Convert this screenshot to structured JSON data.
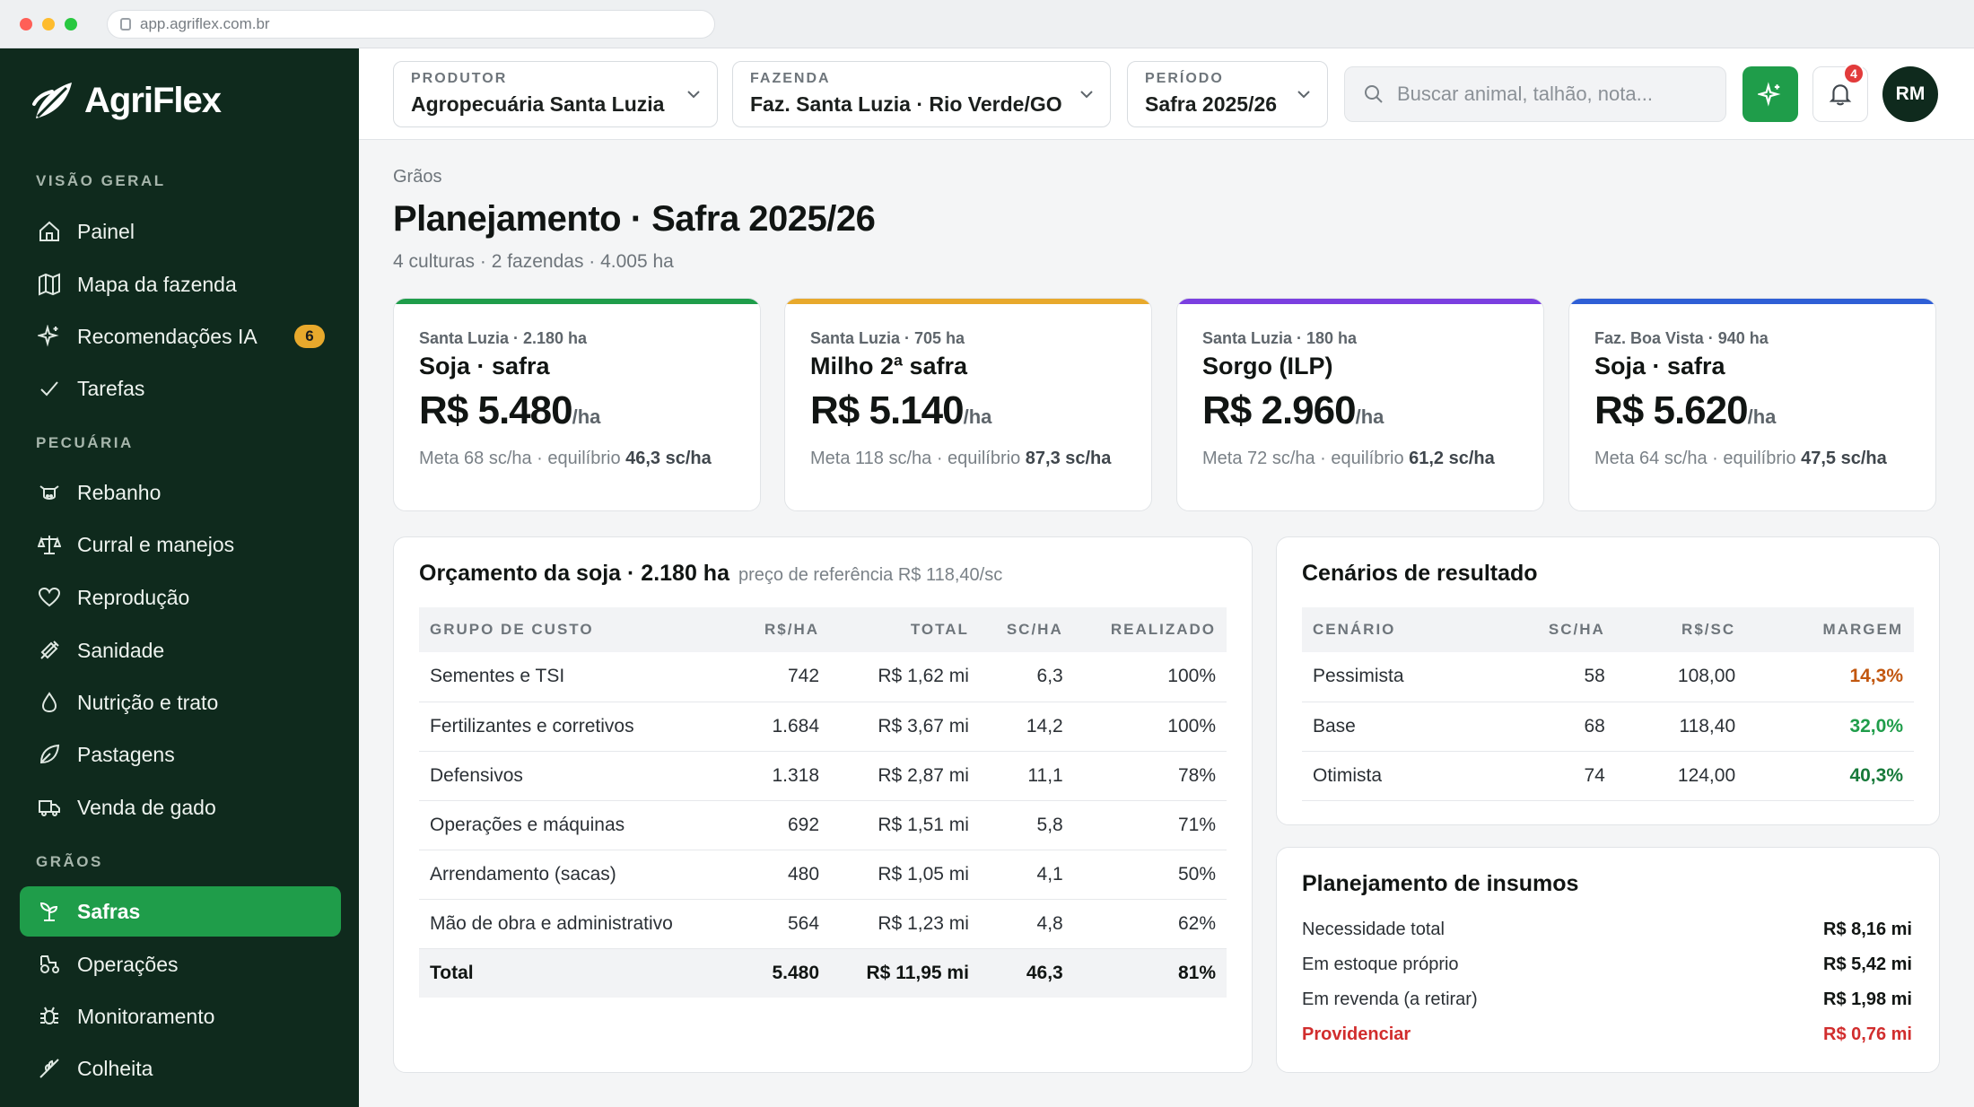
{
  "browser": {
    "url": "app.agriflex.com.br"
  },
  "brand": {
    "name": "AgriFlex",
    "accent": "#1f9d4a",
    "sidebar_bg": "#0f2a1d"
  },
  "sidebar": {
    "sections": [
      {
        "title": "VISÃO GERAL",
        "items": [
          {
            "label": "Painel",
            "icon": "home-icon"
          },
          {
            "label": "Mapa da fazenda",
            "icon": "map-icon"
          },
          {
            "label": "Recomendações IA",
            "icon": "sparkle-icon",
            "badge": "6"
          },
          {
            "label": "Tarefas",
            "icon": "check-icon"
          }
        ]
      },
      {
        "title": "PECUÁRIA",
        "items": [
          {
            "label": "Rebanho",
            "icon": "cow-icon"
          },
          {
            "label": "Curral e manejos",
            "icon": "scale-icon"
          },
          {
            "label": "Reprodução",
            "icon": "heart-icon"
          },
          {
            "label": "Sanidade",
            "icon": "syringe-icon"
          },
          {
            "label": "Nutrição e trato",
            "icon": "drop-icon"
          },
          {
            "label": "Pastagens",
            "icon": "leaf-icon"
          },
          {
            "label": "Venda de gado",
            "icon": "truck-icon"
          }
        ]
      },
      {
        "title": "GRÃOS",
        "items": [
          {
            "label": "Safras",
            "icon": "sprout-icon",
            "active": true
          },
          {
            "label": "Operações",
            "icon": "tractor-icon"
          },
          {
            "label": "Monitoramento",
            "icon": "bug-icon"
          },
          {
            "label": "Colheita",
            "icon": "wheat-icon"
          }
        ]
      }
    ]
  },
  "topbar": {
    "producer": {
      "label": "PRODUTOR",
      "value": "Agropecuária Santa Luzia"
    },
    "farm": {
      "label": "FAZENDA",
      "value": "Faz. Santa Luzia · Rio Verde/GO"
    },
    "period": {
      "label": "PERÍODO",
      "value": "Safra 2025/26"
    },
    "search_placeholder": "Buscar animal, talhão, nota...",
    "notifications": "4",
    "avatar": "RM"
  },
  "page": {
    "breadcrumb": "Grãos",
    "title": "Planejamento · Safra 2025/26",
    "subtitle": "4 culturas · 2 fazendas · 4.005 ha"
  },
  "crops": [
    {
      "meta": "Santa Luzia · 2.180 ha",
      "name": "Soja · safra",
      "price": "R$ 5.480",
      "unit": "/ha",
      "goal": "Meta 68 sc/ha · equilíbrio ",
      "breakeven": "46,3 sc/ha",
      "color": "#1f9d4a"
    },
    {
      "meta": "Santa Luzia · 705 ha",
      "name": "Milho 2ª safra",
      "price": "R$ 5.140",
      "unit": "/ha",
      "goal": "Meta 118 sc/ha · equilíbrio ",
      "breakeven": "87,3 sc/ha",
      "color": "#e8a92c"
    },
    {
      "meta": "Santa Luzia · 180 ha",
      "name": "Sorgo (ILP)",
      "price": "R$ 2.960",
      "unit": "/ha",
      "goal": "Meta 72 sc/ha · equilíbrio ",
      "breakeven": "61,2 sc/ha",
      "color": "#7b3fe0"
    },
    {
      "meta": "Faz. Boa Vista · 940 ha",
      "name": "Soja · safra",
      "price": "R$ 5.620",
      "unit": "/ha",
      "goal": "Meta 64 sc/ha · equilíbrio ",
      "breakeven": "47,5 sc/ha",
      "color": "#2f5fd6"
    }
  ],
  "budget": {
    "title": "Orçamento da soja · 2.180 ha",
    "hint": "preço de referência R$ 118,40/sc",
    "headers": [
      "GRUPO DE CUSTO",
      "R$/HA",
      "TOTAL",
      "SC/HA",
      "REALIZADO"
    ],
    "rows": [
      [
        "Sementes e TSI",
        "742",
        "R$ 1,62 mi",
        "6,3",
        "100%"
      ],
      [
        "Fertilizantes e corretivos",
        "1.684",
        "R$ 3,67 mi",
        "14,2",
        "100%"
      ],
      [
        "Defensivos",
        "1.318",
        "R$ 2,87 mi",
        "11,1",
        "78%"
      ],
      [
        "Operações e máquinas",
        "692",
        "R$ 1,51 mi",
        "5,8",
        "71%"
      ],
      [
        "Arrendamento (sacas)",
        "480",
        "R$ 1,05 mi",
        "4,1",
        "50%"
      ],
      [
        "Mão de obra e administrativo",
        "564",
        "R$ 1,23 mi",
        "4,8",
        "62%"
      ]
    ],
    "total": [
      "Total",
      "5.480",
      "R$ 11,95 mi",
      "46,3",
      "81%"
    ]
  },
  "scenarios": {
    "title": "Cenários de resultado",
    "headers": [
      "CENÁRIO",
      "SC/HA",
      "R$/SC",
      "MARGEM"
    ],
    "rows": [
      {
        "name": "Pessimista",
        "sc": "58",
        "rs": "108,00",
        "margin": "14,3%",
        "color": "#c2570f"
      },
      {
        "name": "Base",
        "sc": "68",
        "rs": "118,40",
        "margin": "32,0%",
        "color": "#1f9d4a"
      },
      {
        "name": "Otimista",
        "sc": "74",
        "rs": "124,00",
        "margin": "40,3%",
        "color": "#177a3a"
      }
    ]
  },
  "inputs": {
    "title": "Planejamento de insumos",
    "rows": [
      {
        "label": "Necessidade total",
        "value": "R$ 8,16 mi"
      },
      {
        "label": "Em estoque próprio",
        "value": "R$ 5,42 mi"
      },
      {
        "label": "Em revenda (a retirar)",
        "value": "R$ 1,98 mi"
      },
      {
        "label": "Providenciar",
        "value": "R$ 0,76 mi",
        "alert": true
      }
    ]
  }
}
